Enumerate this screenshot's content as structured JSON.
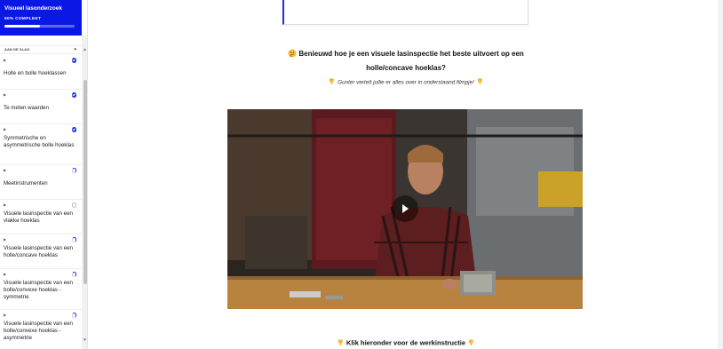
{
  "sidebar": {
    "course_title": "Visueel lasonderzoek",
    "progress_label": "50% COMPLEET",
    "progress_fraction": 0.5,
    "accent_color": "#0a18e6",
    "section_label": "AAN DE SLAG",
    "section_icon": "chevron-down-icon",
    "lessons": [
      {
        "type_icon": "play-icon",
        "title": "Holle en bolle hoeklassen",
        "status": "completed"
      },
      {
        "type_icon": "play-icon",
        "title": "Te meten waarden",
        "status": "completed"
      },
      {
        "type_icon": "play-icon",
        "title": "Symmetrische en asymmetrische bolle hoeklas",
        "status": "completed"
      },
      {
        "type_icon": "play-icon",
        "title": "Meetinstrumenten",
        "status": "in-progress"
      },
      {
        "type_icon": "play-icon",
        "title": "Visuele lasinspectie van een vlakke hoeklas",
        "status": "not-started"
      },
      {
        "type_icon": "play-icon",
        "title": "Visuele lasinspectie van een holle/concave hoeklas",
        "status": "in-progress"
      },
      {
        "type_icon": "play-icon",
        "title": "Visuele lasinspectie van een bolle/convexe hoeklas - symmetrie",
        "status": "in-progress"
      },
      {
        "type_icon": "play-icon",
        "title": "Visuele lasinspectie van een bolle/convexe hoeklas - asymmetrie",
        "status": "in-progress"
      }
    ]
  },
  "main": {
    "heading_icon": "thinking-face-icon",
    "heading_line1": "Benieuwd hoe je een visuele lasinspectie het beste uitvoert op een",
    "heading_line2": "holle/concave hoeklas?",
    "sub_icon": "pointing-down-icon",
    "subheading": "Gunter vertelt jullie er alles over in onderstaand filmpje!",
    "video_icon": "play-icon",
    "cta_icon": "pointing-down-icon",
    "cta_text": "Klik hieronder voor de werkinstructie"
  }
}
